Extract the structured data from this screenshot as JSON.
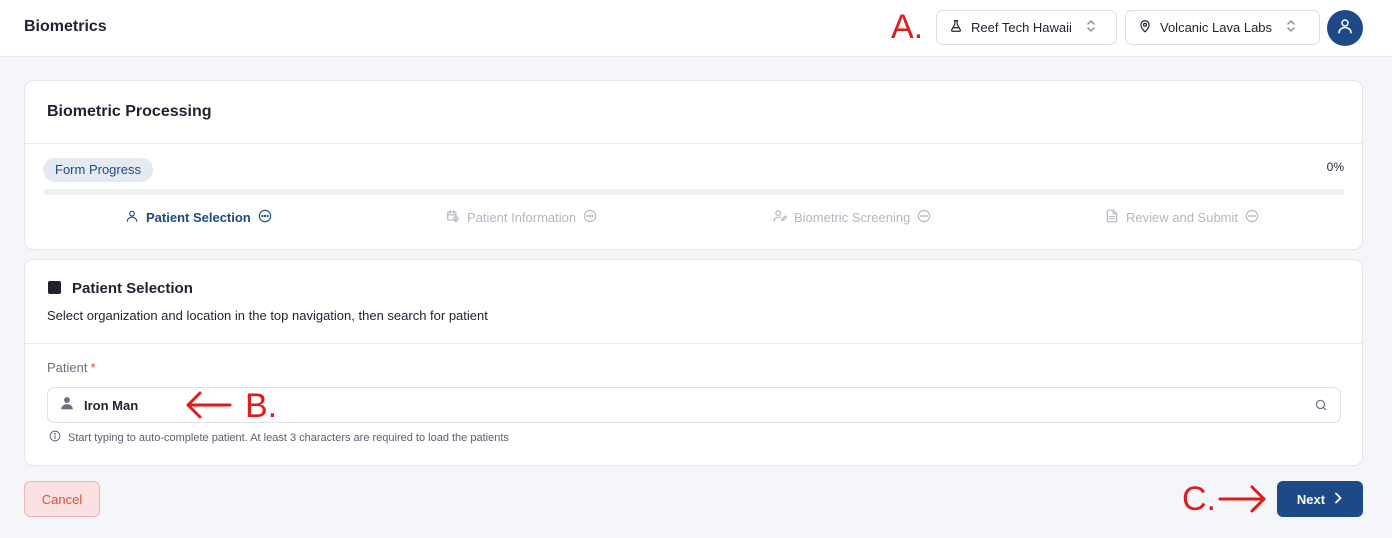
{
  "header": {
    "title": "Biometrics",
    "organization": "Reef Tech Hawaii",
    "location": "Volcanic Lava Labs"
  },
  "annotations": {
    "a": "A.",
    "b": "B.",
    "c": "C."
  },
  "processing": {
    "title": "Biometric Processing",
    "progress_label": "Form Progress",
    "progress_value": "0%",
    "progress_fraction": 0,
    "steps": [
      {
        "label": "Patient Selection",
        "status": "active"
      },
      {
        "label": "Patient Information",
        "status": "inactive"
      },
      {
        "label": "Biometric Screening",
        "status": "inactive"
      },
      {
        "label": "Review and Submit",
        "status": "inactive"
      }
    ]
  },
  "patient_section": {
    "title": "Patient Selection",
    "subtitle": "Select organization and location in the top navigation, then search for patient",
    "field_label": "Patient",
    "required_mark": "*",
    "value": "Iron Man",
    "hint": "Start typing to auto-complete patient. At least 3 characters are required to load the patients"
  },
  "actions": {
    "cancel": "Cancel",
    "next": "Next"
  },
  "colors": {
    "primary": "#1d4a86",
    "danger": "#e5483c",
    "annotation": "#e11a1a"
  }
}
